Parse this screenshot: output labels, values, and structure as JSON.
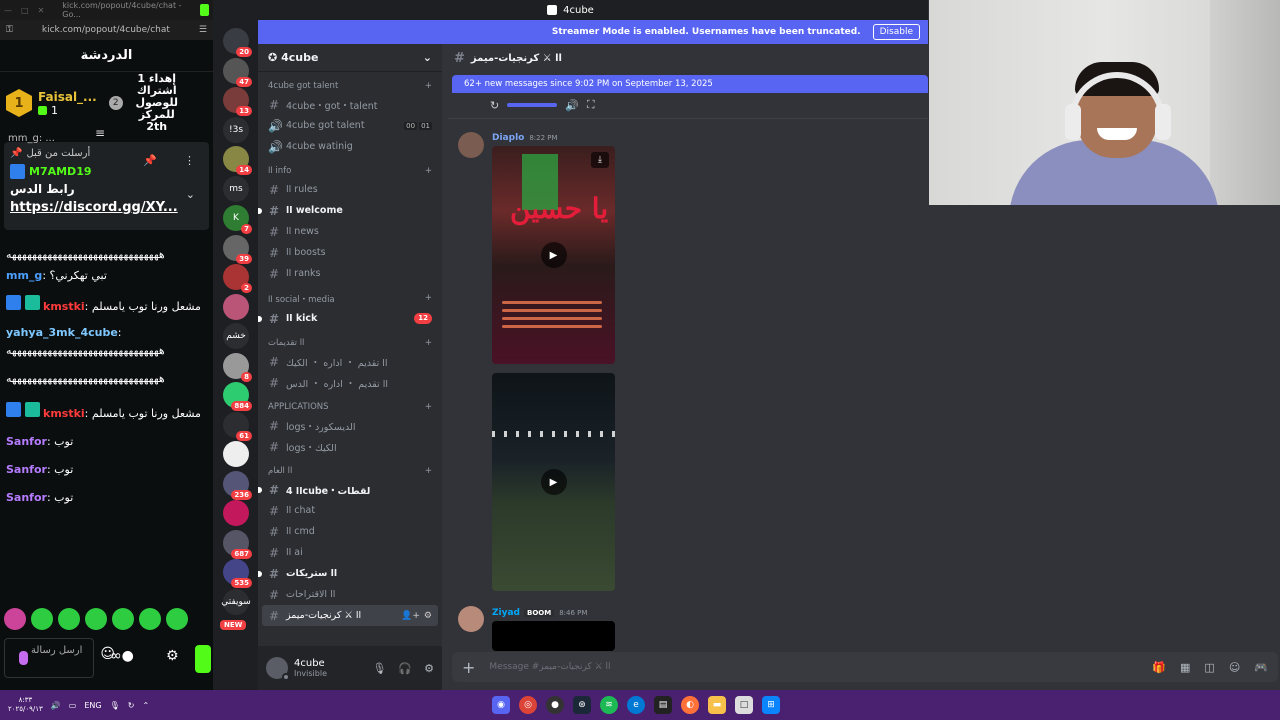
{
  "kick": {
    "tab_title": "kick.com/popout/4cube/chat - Go...",
    "url": "kick.com/popout/4cube/chat",
    "header": "الدردشة",
    "leader": {
      "rank_badge": "1",
      "name": "Faisal_...",
      "count": "1",
      "rank2": "2",
      "note": "إهداء 1 اشتراك للوصول للمركز 2th"
    },
    "pinned": {
      "cut_text": "mm_g: ...",
      "label": "أرسلت من قبل",
      "user": "M7AMD19",
      "body": "رابط الدس",
      "link": "https://discord.gg/XY..."
    },
    "messages": [
      {
        "name": "",
        "text": "ههههههههههههههههههههههههههههههه",
        "color": "#ffffff"
      },
      {
        "name": "mm_g",
        "text": "تبي تهكرني؟",
        "color": "#4c9fff"
      },
      {
        "name": "kmstki",
        "text": "مشعل ورنا توب يامسلم",
        "color": "#ff3b3b",
        "badges": true
      },
      {
        "name": "yahya_3mk_4cube",
        "text": "",
        "color": "#7ec8ff"
      },
      {
        "name": "",
        "text": "ههههههههههههههههههههههههههههههه",
        "color": "#ffffff"
      },
      {
        "name": "",
        "text": "ههههههههههههههههههههههههههههههه",
        "color": "#ffffff"
      },
      {
        "name": "kmstki",
        "text": "مشعل ورنا توب يامسلم",
        "color": "#ff3b3b",
        "badges": true
      },
      {
        "name": "Sanfor",
        "text": "توب",
        "color": "#b57cff"
      },
      {
        "name": "Sanfor",
        "text": "توب",
        "color": "#b57cff"
      },
      {
        "name": "Sanfor",
        "text": "توب",
        "color": "#b57cff"
      }
    ],
    "input_placeholder": "ارسل رسالة",
    "brand_color": "#53fc18"
  },
  "discord": {
    "window_title": "4cube",
    "streamer_banner": "Streamer Mode is enabled. Usernames have been truncated.",
    "disable_label": "Disable",
    "server_name": "4cube",
    "servers": [
      {
        "label": "",
        "badge": "20"
      },
      {
        "label": "",
        "badge": "47"
      },
      {
        "label": "",
        "badge": "13"
      },
      {
        "label": "!3s",
        "badge": ""
      },
      {
        "label": "",
        "badge": "14"
      },
      {
        "label": "ms",
        "badge": ""
      },
      {
        "label": "K",
        "badge": "7"
      },
      {
        "label": "",
        "badge": "39"
      },
      {
        "label": "",
        "badge": "2"
      },
      {
        "label": "",
        "badge": ""
      },
      {
        "label": "خشم",
        "badge": ""
      },
      {
        "label": "",
        "badge": "8"
      },
      {
        "label": "",
        "badge": "884"
      },
      {
        "label": "",
        "badge": "61"
      },
      {
        "label": "",
        "badge": ""
      },
      {
        "label": "",
        "badge": "236"
      },
      {
        "label": "",
        "badge": ""
      },
      {
        "label": "",
        "badge": "687"
      },
      {
        "label": "",
        "badge": "535"
      },
      {
        "label": "سويفتي",
        "badge": ""
      }
    ],
    "new_label": "NEW",
    "categories": [
      {
        "name": "4cube got talent",
        "channels": [
          {
            "name": "4cube・got・talent",
            "type": "text"
          },
          {
            "name": "4cube got talent",
            "type": "voice",
            "vc": [
              "00",
              "01"
            ]
          },
          {
            "name": "4cube watinig",
            "type": "voice"
          }
        ]
      },
      {
        "name": "اا info",
        "channels": [
          {
            "name": "اا rules",
            "type": "text"
          },
          {
            "name": "اا welcome",
            "type": "text",
            "bold": true
          },
          {
            "name": "اا news",
            "type": "text"
          },
          {
            "name": "اا boosts",
            "type": "text"
          },
          {
            "name": "اا ranks",
            "type": "text"
          }
        ]
      },
      {
        "name": "اا social・media",
        "channels": [
          {
            "name": "اا kick",
            "type": "text",
            "bold": true,
            "count": "12"
          }
        ]
      },
      {
        "name": "اا تقديمات",
        "channels": [
          {
            "name": "اا تقديم ・ اداره ・ الكيك",
            "type": "text"
          },
          {
            "name": "اا تقديم ・ اداره ・ الدس",
            "type": "text"
          }
        ]
      },
      {
        "name": "APPLICATIONS",
        "channels": [
          {
            "name": "logs・الديسكورد",
            "type": "text"
          },
          {
            "name": "logs・الكيك",
            "type": "text"
          }
        ]
      },
      {
        "name": "اا العام",
        "channels": [
          {
            "name": "اا 4cube・لقطات",
            "type": "text",
            "bold": true
          },
          {
            "name": "اا chat",
            "type": "text"
          },
          {
            "name": "اا cmd",
            "type": "text"
          },
          {
            "name": "اا ai",
            "type": "text"
          },
          {
            "name": "اا ستريكات",
            "type": "text",
            "bold": true
          },
          {
            "name": "اا الاقتراحات",
            "type": "text"
          },
          {
            "name": "اا ⚔ كرنجيات-ميمز",
            "type": "text",
            "active": true
          }
        ]
      }
    ],
    "user": {
      "name": "4cube",
      "status": "Invisible"
    },
    "channel_header": "اا ⚔ كرنجيات-ميمز",
    "new_messages_bar": "62+ new messages since 9:02 PM on September 13, 2025",
    "messages": [
      {
        "author": "Diaplo",
        "time": "8:22 PM",
        "color": "#7ca5f4"
      },
      {
        "author": "Ziyad",
        "time": "8:46 PM",
        "color": "#00a8fc",
        "tag": "BOOM"
      }
    ],
    "video_caption": "يا حسين",
    "composer_placeholder": "Message #اا ⚔ كرنجيات-ميمز"
  },
  "taskbar": {
    "time": "٨:٣٣",
    "date": "٢٠٢٥/٠٩/١٣",
    "lang": "ENG"
  }
}
